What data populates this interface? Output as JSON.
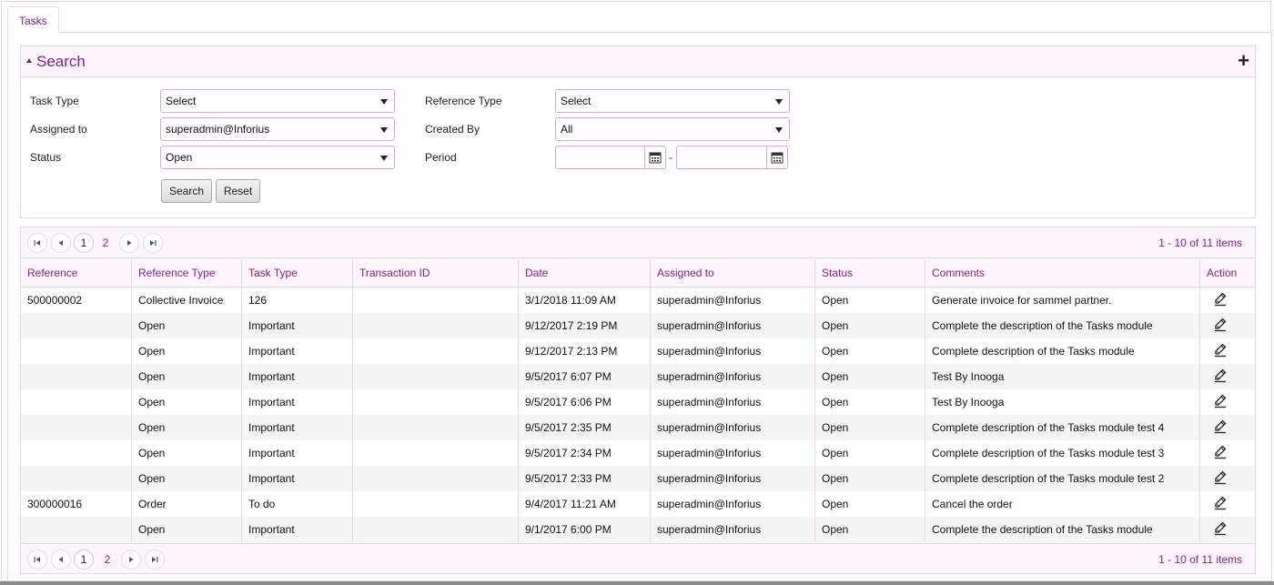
{
  "tabs": [
    {
      "label": "Tasks"
    }
  ],
  "search": {
    "title": "Search",
    "fields": {
      "task_type": {
        "label": "Task Type",
        "value": "Select"
      },
      "reference_type": {
        "label": "Reference Type",
        "value": "Select"
      },
      "assigned_to": {
        "label": "Assigned to",
        "value": "superadmin@Inforius"
      },
      "created_by": {
        "label": "Created By",
        "value": "All"
      },
      "status": {
        "label": "Status",
        "value": "Open"
      },
      "period": {
        "label": "Period",
        "from": "",
        "to": "",
        "separator": "-"
      }
    },
    "search_button": "Search",
    "reset_button": "Reset"
  },
  "pager": {
    "pages": [
      "1",
      "2"
    ],
    "current_page": "1",
    "info": "1 - 10 of 11 items"
  },
  "table": {
    "columns": [
      "Reference",
      "Reference Type",
      "Task Type",
      "Transaction ID",
      "Date",
      "Assigned to",
      "Status",
      "Comments",
      "Action"
    ],
    "rows": [
      {
        "reference": "500000002",
        "reference_type": "Collective Invoice",
        "task_type": "126",
        "transaction_id": "",
        "date": "3/1/2018 11:09 AM",
        "assigned_to": "superadmin@Inforius",
        "status": "Open",
        "comments": "Generate invoice for sammel partner."
      },
      {
        "reference": "",
        "reference_type": "Open",
        "task_type": "Important",
        "transaction_id": "",
        "date": "9/12/2017 2:19 PM",
        "assigned_to": "superadmin@Inforius",
        "status": "Open",
        "comments": "Complete the description of the Tasks module"
      },
      {
        "reference": "",
        "reference_type": "Open",
        "task_type": "Important",
        "transaction_id": "",
        "date": "9/12/2017 2:13 PM",
        "assigned_to": "superadmin@Inforius",
        "status": "Open",
        "comments": "Complete description of the Tasks module"
      },
      {
        "reference": "",
        "reference_type": "Open",
        "task_type": "Important",
        "transaction_id": "",
        "date": "9/5/2017 6:07 PM",
        "assigned_to": "superadmin@Inforius",
        "status": "Open",
        "comments": "Test By Inooga"
      },
      {
        "reference": "",
        "reference_type": "Open",
        "task_type": "Important",
        "transaction_id": "",
        "date": "9/5/2017 6:06 PM",
        "assigned_to": "superadmin@Inforius",
        "status": "Open",
        "comments": "Test By Inooga"
      },
      {
        "reference": "",
        "reference_type": "Open",
        "task_type": "Important",
        "transaction_id": "",
        "date": "9/5/2017 2:35 PM",
        "assigned_to": "superadmin@Inforius",
        "status": "Open",
        "comments": "Complete description of the Tasks module test 4"
      },
      {
        "reference": "",
        "reference_type": "Open",
        "task_type": "Important",
        "transaction_id": "",
        "date": "9/5/2017 2:34 PM",
        "assigned_to": "superadmin@Inforius",
        "status": "Open",
        "comments": "Complete description of the Tasks module test 3"
      },
      {
        "reference": "",
        "reference_type": "Open",
        "task_type": "Important",
        "transaction_id": "",
        "date": "9/5/2017 2:33 PM",
        "assigned_to": "superadmin@Inforius",
        "status": "Open",
        "comments": "Complete description of the Tasks module test 2"
      },
      {
        "reference": "300000016",
        "reference_type": "Order",
        "task_type": "To do",
        "transaction_id": "",
        "date": "9/4/2017 11:21 AM",
        "assigned_to": "superadmin@Inforius",
        "status": "Open",
        "comments": "Cancel the order"
      },
      {
        "reference": "",
        "reference_type": "Open",
        "task_type": "Important",
        "transaction_id": "",
        "date": "9/1/2017 6:00 PM",
        "assigned_to": "superadmin@Inforius",
        "status": "Open",
        "comments": "Complete the description of the Tasks module"
      }
    ]
  },
  "icons": {
    "collapse": "triangle-up-icon",
    "add": "plus-icon",
    "calendar": "calendar-icon",
    "edit": "edit-pencil-icon"
  },
  "colors": {
    "accent": "#8b1e8b",
    "border": "#ead4ea",
    "header_bg": "#fcf5fc"
  }
}
